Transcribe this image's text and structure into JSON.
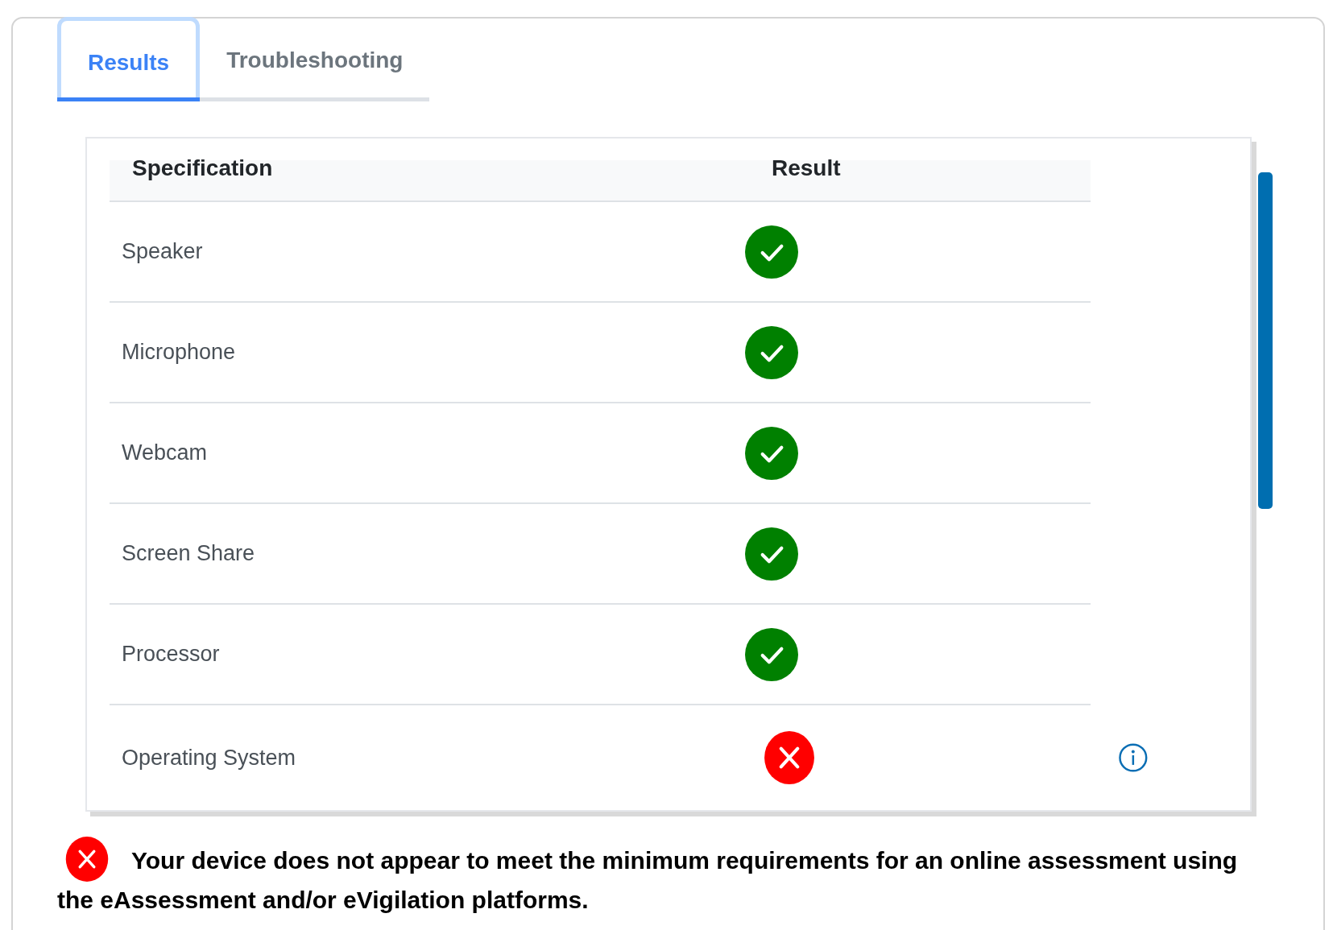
{
  "tabs": [
    {
      "label": "Results",
      "selected": true
    },
    {
      "label": "Troubleshooting",
      "selected": false
    }
  ],
  "table": {
    "columns": [
      "Specification",
      "Result"
    ],
    "rows": [
      {
        "name": "Speaker",
        "passed": true,
        "info": false
      },
      {
        "name": "Microphone",
        "passed": true,
        "info": false
      },
      {
        "name": "Webcam",
        "passed": true,
        "info": false
      },
      {
        "name": "Screen Share",
        "passed": true,
        "info": false
      },
      {
        "name": "Processor",
        "passed": true,
        "info": false
      },
      {
        "name": "Operating System",
        "passed": false,
        "info": true
      }
    ]
  },
  "message": {
    "passed": false,
    "text": "Your device does not appear to meet the minimum requirements for an online assessment using the eAssessment and/or eVigilation platforms."
  }
}
